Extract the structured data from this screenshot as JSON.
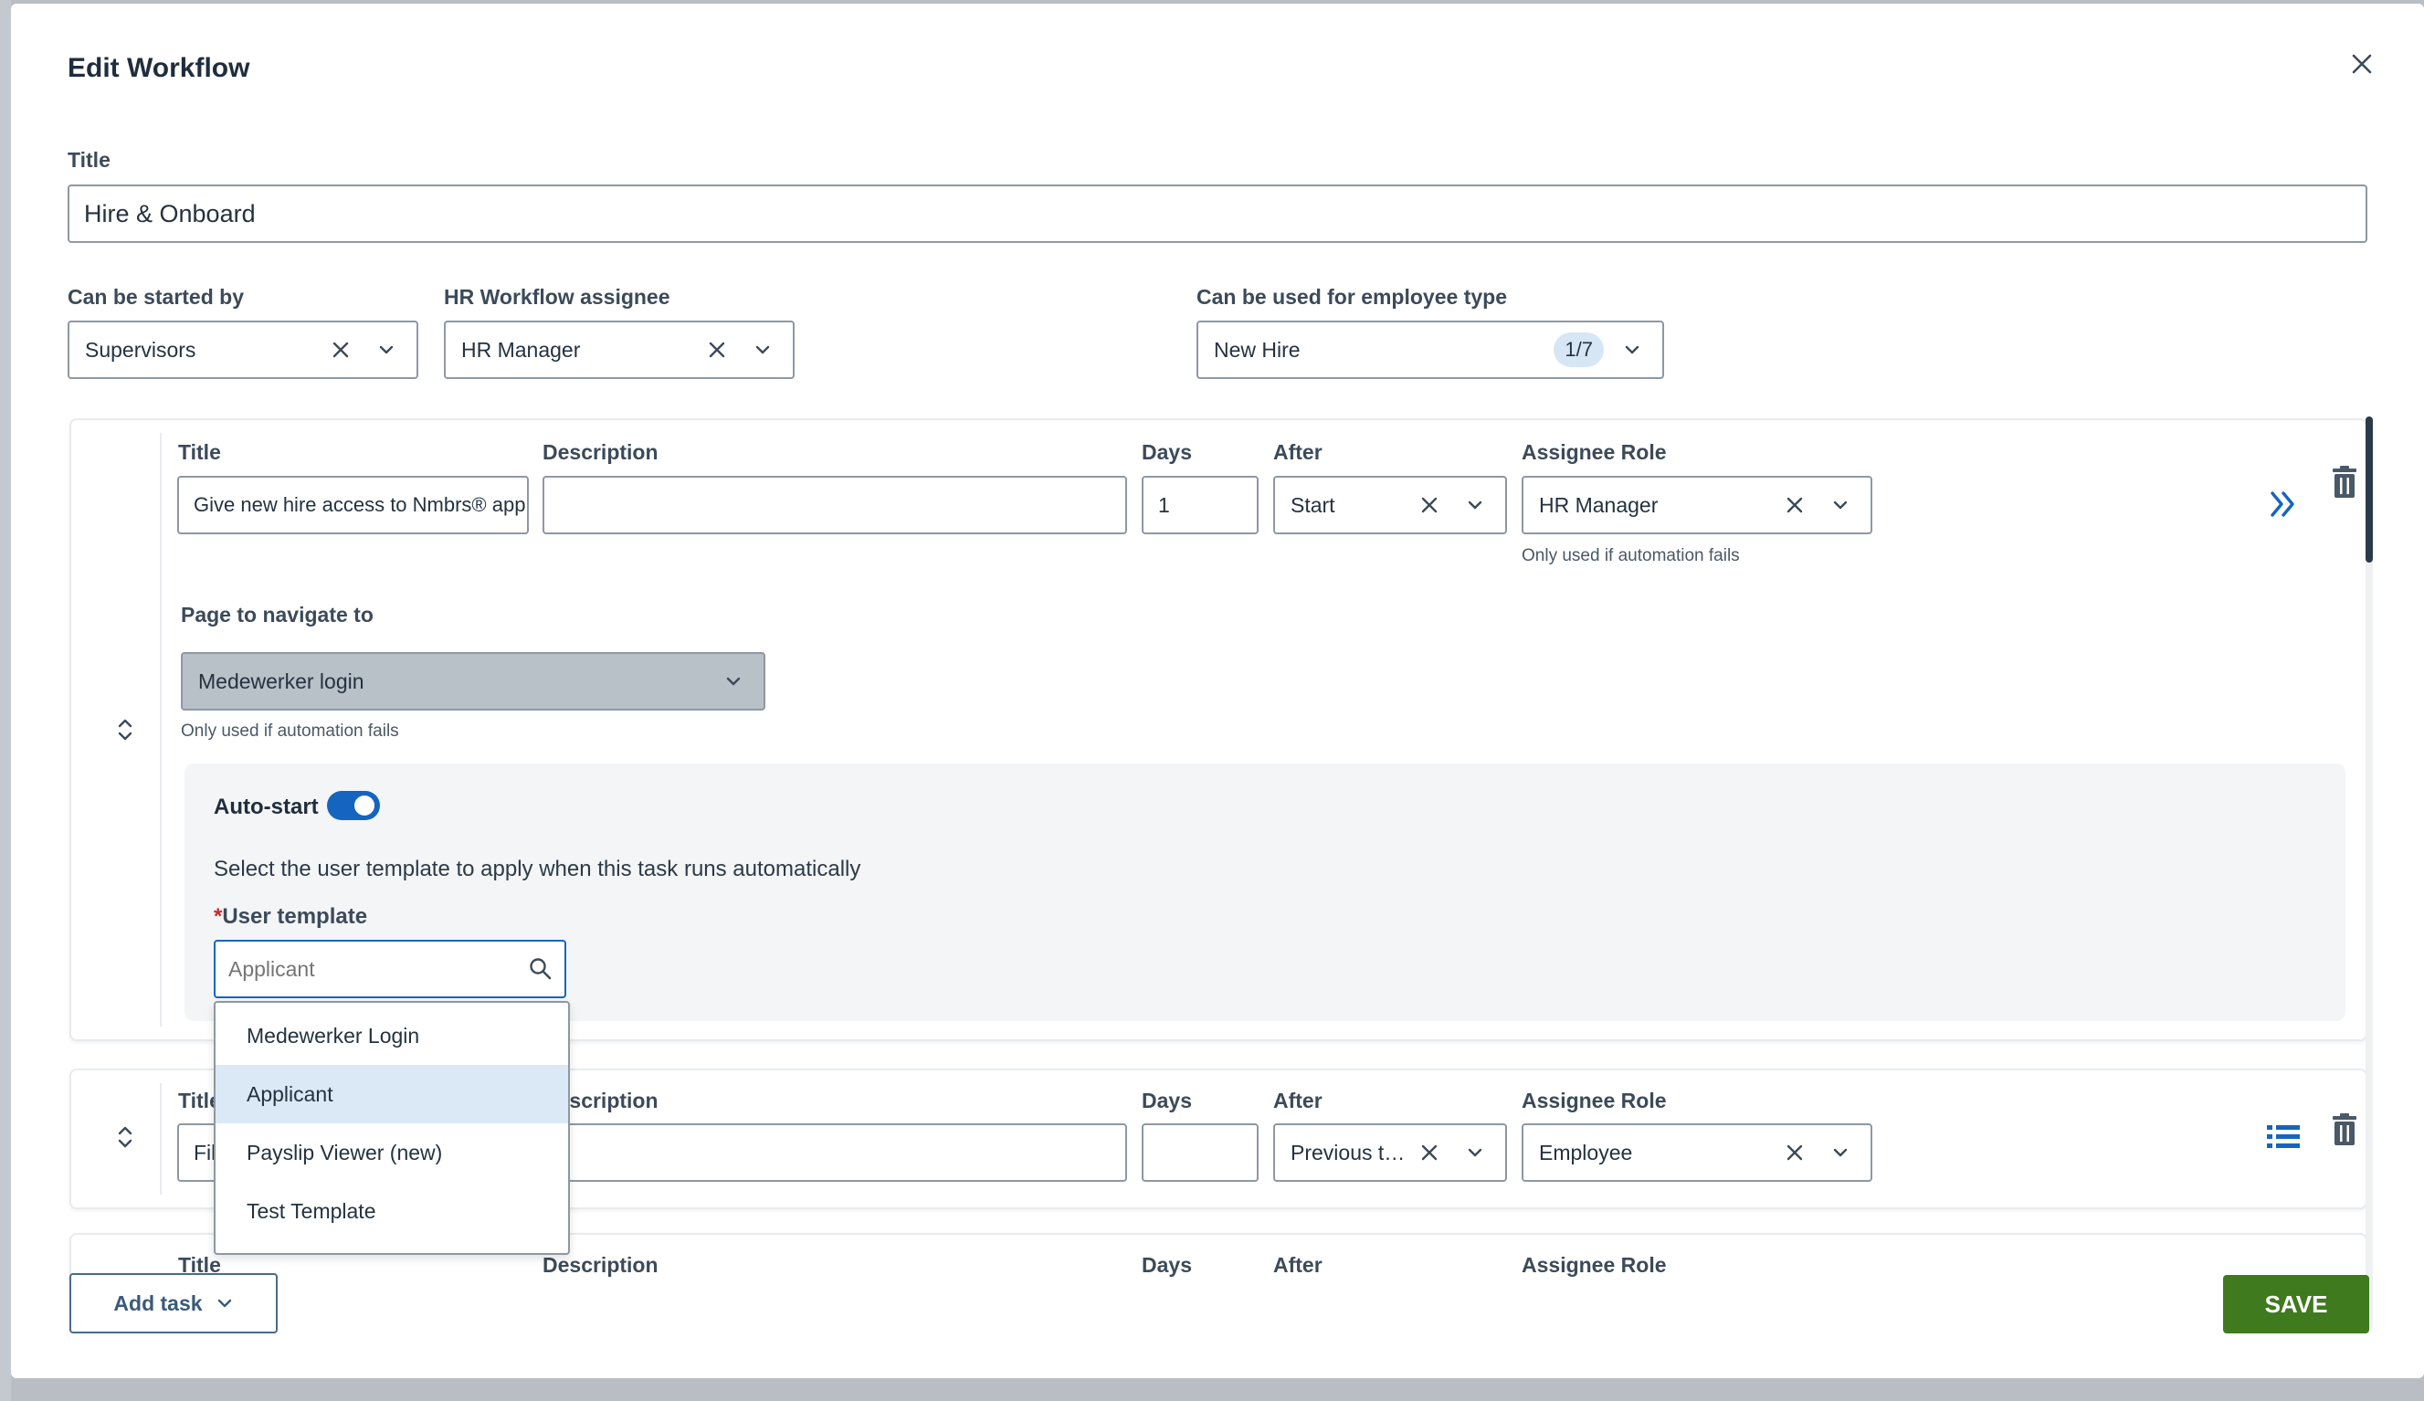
{
  "modal": {
    "title": "Edit Workflow",
    "close_icon": "close-icon"
  },
  "form": {
    "title_label": "Title",
    "title_value": "Hire & Onboard",
    "started_by_label": "Can be started by",
    "started_by_value": "Supervisors",
    "hr_assignee_label": "HR Workflow assignee",
    "hr_assignee_value": "HR Manager",
    "employee_type_label": "Can be used for employee type",
    "employee_type_value": "New Hire",
    "employee_type_count": "1/7"
  },
  "task1": {
    "title_label": "Title",
    "title_value": "Give new hire access to Nmbrs® app",
    "description_label": "Description",
    "description_value": "",
    "days_label": "Days",
    "days_value": "1",
    "after_label": "After",
    "after_value": "Start",
    "assignee_label": "Assignee Role",
    "assignee_value": "HR Manager",
    "assignee_hint": "Only used if automation fails",
    "page_label": "Page to navigate to",
    "page_value": "Medewerker login",
    "page_hint": "Only used if automation fails",
    "autostart_label": "Auto-start",
    "autostart_on": true,
    "autostart_text": "Select the user template to apply when this task runs automatically",
    "template_required_mark": "*",
    "template_label": "User template",
    "template_placeholder": "Applicant"
  },
  "template_options": [
    "Medewerker Login",
    "Applicant",
    "Payslip Viewer (new)",
    "Test Template"
  ],
  "template_active_index": 1,
  "task2": {
    "title_label": "Title",
    "title_value": "Fil",
    "description_label": "Description",
    "days_label": "Days",
    "days_value": "",
    "after_label": "After",
    "after_value": "Previous task",
    "assignee_label": "Assignee Role",
    "assignee_value": "Employee"
  },
  "task3": {
    "title_label": "Title",
    "description_label": "Description",
    "days_label": "Days",
    "after_label": "After",
    "assignee_label": "Assignee Role"
  },
  "footer": {
    "add_task_label": "Add task",
    "save_label": "SAVE"
  },
  "colors": {
    "accent": "#1565c0",
    "save": "#3f7a1e",
    "disabled_select": "#b8c0c8"
  }
}
